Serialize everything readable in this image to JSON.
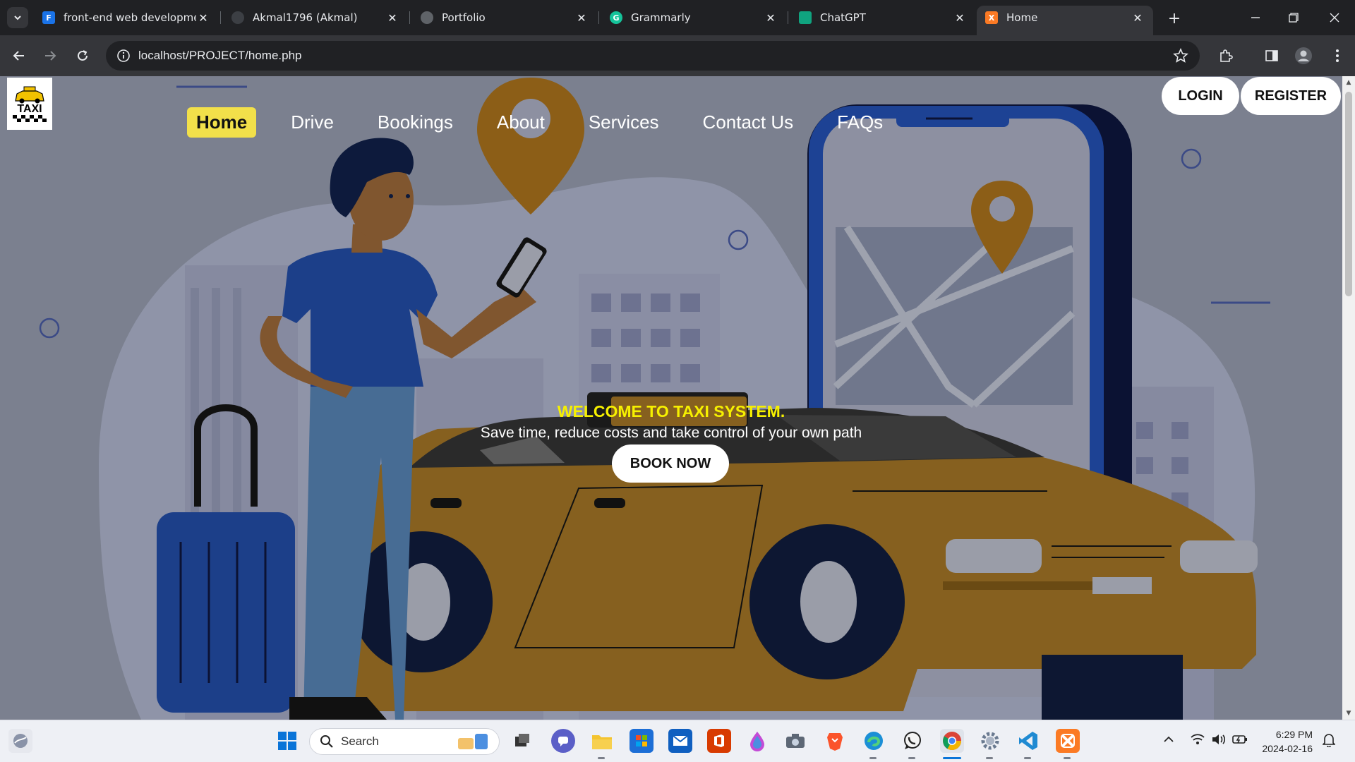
{
  "browser": {
    "tabs": [
      {
        "title": "front-end web developme",
        "favicon_color": "#1a73e8",
        "favicon_letter": "F"
      },
      {
        "title": "Akmal1796 (Akmal)",
        "favicon_color": "#24292f",
        "favicon_letter": ""
      },
      {
        "title": "Portfolio",
        "favicon_color": "#5f6368",
        "favicon_letter": ""
      },
      {
        "title": "Grammarly",
        "favicon_color": "#15c39a",
        "favicon_letter": "G"
      },
      {
        "title": "ChatGPT",
        "favicon_color": "#10a37f",
        "favicon_letter": ""
      },
      {
        "title": "Home",
        "favicon_color": "#fb7a24",
        "favicon_letter": "X"
      }
    ],
    "active_tab_index": 5,
    "url": "localhost/PROJECT/home.php"
  },
  "site": {
    "logo_text": "TAXI",
    "nav": [
      {
        "label": "Home",
        "active": true
      },
      {
        "label": "Drive",
        "active": false
      },
      {
        "label": "Bookings",
        "active": false
      },
      {
        "label": "About",
        "active": false
      },
      {
        "label": "Services",
        "active": false
      },
      {
        "label": "Contact Us",
        "active": false
      },
      {
        "label": "FAQs",
        "active": false
      }
    ],
    "login_label": "LOGIN",
    "register_label": "REGISTER",
    "hero_title": "WELCOME TO TAXI SYSTEM.",
    "hero_subtitle": "Save time, reduce costs and take control of your own path",
    "book_label": "BOOK NOW",
    "colors": {
      "accent_yellow": "#f6f000",
      "nav_active": "#f2e04a",
      "car_body": "#8a6a2a",
      "overlay": "#7a7f8e"
    }
  },
  "taskbar": {
    "search_label": "Search",
    "time": "6:29 PM",
    "date": "2024-02-16"
  }
}
